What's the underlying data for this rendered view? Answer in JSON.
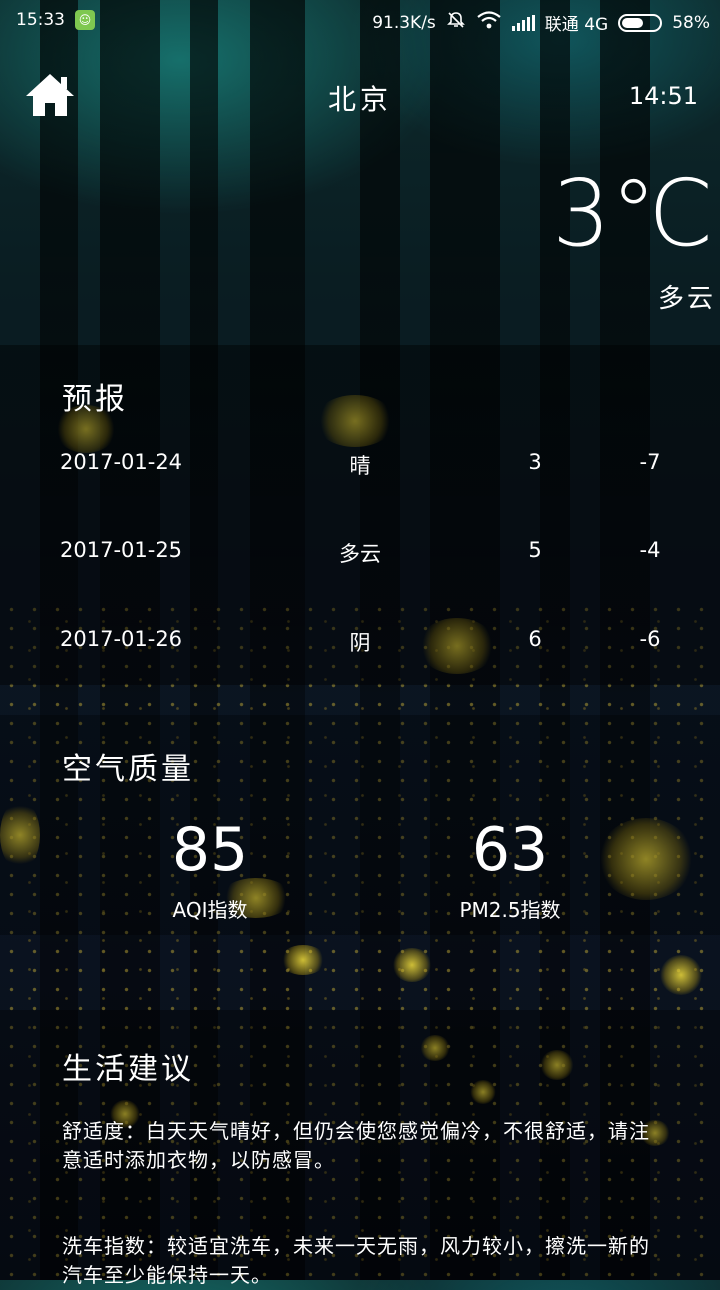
{
  "status_bar": {
    "time": "15:33",
    "net_speed": "91.3K/s",
    "carrier": "联通 4G",
    "battery": "58%",
    "battery_level": 0.58
  },
  "header": {
    "city": "北京",
    "update_time": "14:51"
  },
  "current": {
    "temperature": "3℃",
    "condition": "多云"
  },
  "forecast": {
    "title": "预报",
    "rows": [
      {
        "date": "2017-01-24",
        "condition": "晴",
        "high": "3",
        "low": "-7"
      },
      {
        "date": "2017-01-25",
        "condition": "多云",
        "high": "5",
        "low": "-4"
      },
      {
        "date": "2017-01-26",
        "condition": "阴",
        "high": "6",
        "low": "-6"
      }
    ]
  },
  "air_quality": {
    "title": "空气质量",
    "aqi": {
      "value": "85",
      "label": "AQI指数"
    },
    "pm25": {
      "value": "63",
      "label": "PM2.5指数"
    }
  },
  "suggestion": {
    "title": "生活建议",
    "comfort": "舒适度：白天天气晴好，但仍会使您感觉偏冷，不很舒适，请注意适时添加衣物，以防感冒。",
    "car_wash": "洗车指数：较适宜洗车，未来一天无雨，风力较小，擦洗一新的汽车至少能保持一天。"
  },
  "icons": {
    "home": "home-icon",
    "app": "app-notification-icon",
    "mute": "mute-icon",
    "wifi": "wifi-icon",
    "signal": "signal-icon",
    "battery": "battery-icon"
  }
}
